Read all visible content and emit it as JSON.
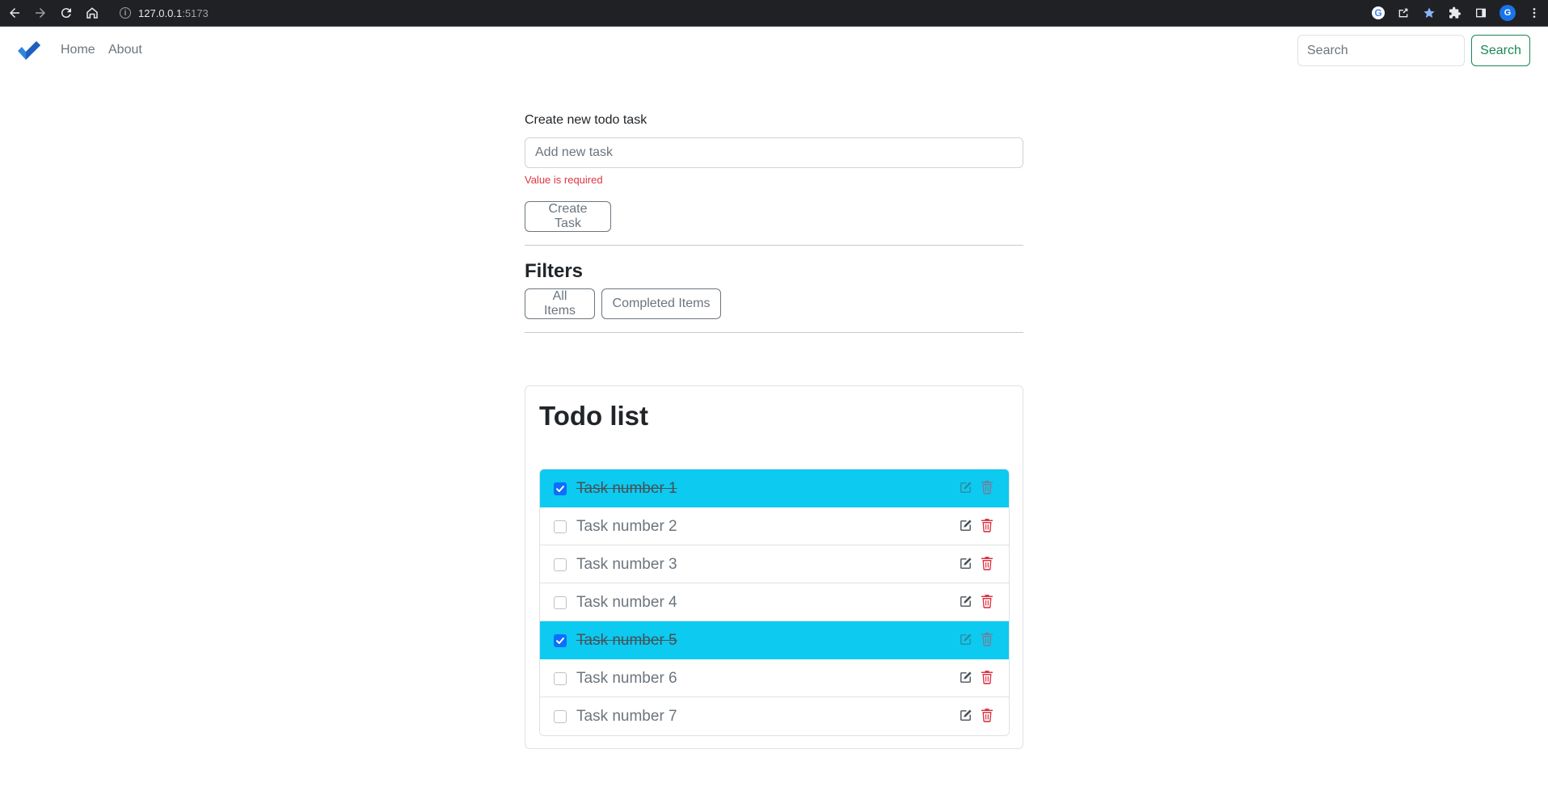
{
  "browser": {
    "url_host": "127.0.0.1",
    "url_port": ":5173",
    "profile_initial": "G"
  },
  "navbar": {
    "links": [
      "Home",
      "About"
    ],
    "search_placeholder": "Search",
    "search_button": "Search"
  },
  "create": {
    "label": "Create new todo task",
    "placeholder": "Add new task",
    "error": "Value is required",
    "button": "Create Task"
  },
  "filters": {
    "title": "Filters",
    "buttons": [
      "All Items",
      "Completed Items"
    ]
  },
  "todo": {
    "title": "Todo list",
    "items": [
      {
        "label": "Task number 1",
        "completed": true
      },
      {
        "label": "Task number 2",
        "completed": false
      },
      {
        "label": "Task number 3",
        "completed": false
      },
      {
        "label": "Task number 4",
        "completed": false
      },
      {
        "label": "Task number 5",
        "completed": true
      },
      {
        "label": "Task number 6",
        "completed": false
      },
      {
        "label": "Task number 7",
        "completed": false
      }
    ]
  },
  "colors": {
    "completed_row": "#0dcaf0",
    "danger": "#dc3545",
    "success": "#198754",
    "checkbox_checked": "#0d6efd"
  },
  "icons": [
    "back-icon",
    "forward-icon",
    "reload-icon",
    "home-icon",
    "info-icon",
    "google-icon",
    "share-icon",
    "star-icon",
    "extensions-icon",
    "sidepanel-icon",
    "menu-icon",
    "brand-check-icon",
    "edit-icon",
    "trash-icon"
  ]
}
